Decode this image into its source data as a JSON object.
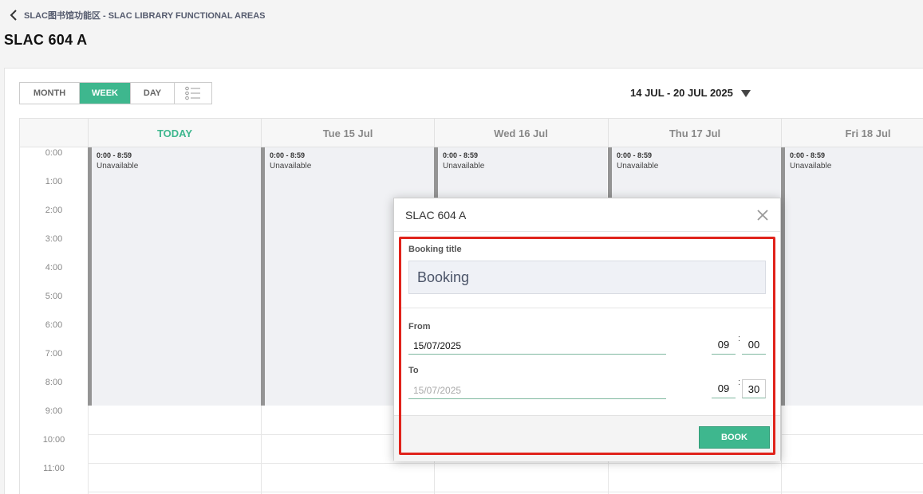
{
  "header": {
    "breadcrumb": "SLAC图书馆功能区 - SLAC LIBRARY FUNCTIONAL AREAS",
    "title": "SLAC 604 A"
  },
  "toolbar": {
    "views": [
      "MONTH",
      "WEEK",
      "DAY"
    ],
    "active_view": "WEEK",
    "date_range": "14 JUL - 20 JUL 2025"
  },
  "calendar": {
    "days": [
      "TODAY",
      "Tue 15 Jul",
      "Wed 16 Jul",
      "Thu 17 Jul",
      "Fri 18 Jul"
    ],
    "hours": [
      "0:00",
      "1:00",
      "2:00",
      "3:00",
      "4:00",
      "5:00",
      "6:00",
      "7:00",
      "8:00",
      "9:00",
      "10:00",
      "11:00"
    ],
    "unavailable": {
      "time": "0:00 - 8:59",
      "label": "Unavailable"
    }
  },
  "modal": {
    "title": "SLAC 604 A",
    "booking_title_label": "Booking title",
    "booking_title_value": "Booking",
    "from_label": "From",
    "from_date": "15/07/2025",
    "from_hour": "09",
    "from_minute": "00",
    "to_label": "To",
    "to_date": "15/07/2025",
    "to_hour": "09",
    "to_minute": "30",
    "colon": ":",
    "book_label": "BOOK"
  },
  "colors": {
    "accent": "#3eb78e",
    "highlight": "#e0231b"
  }
}
